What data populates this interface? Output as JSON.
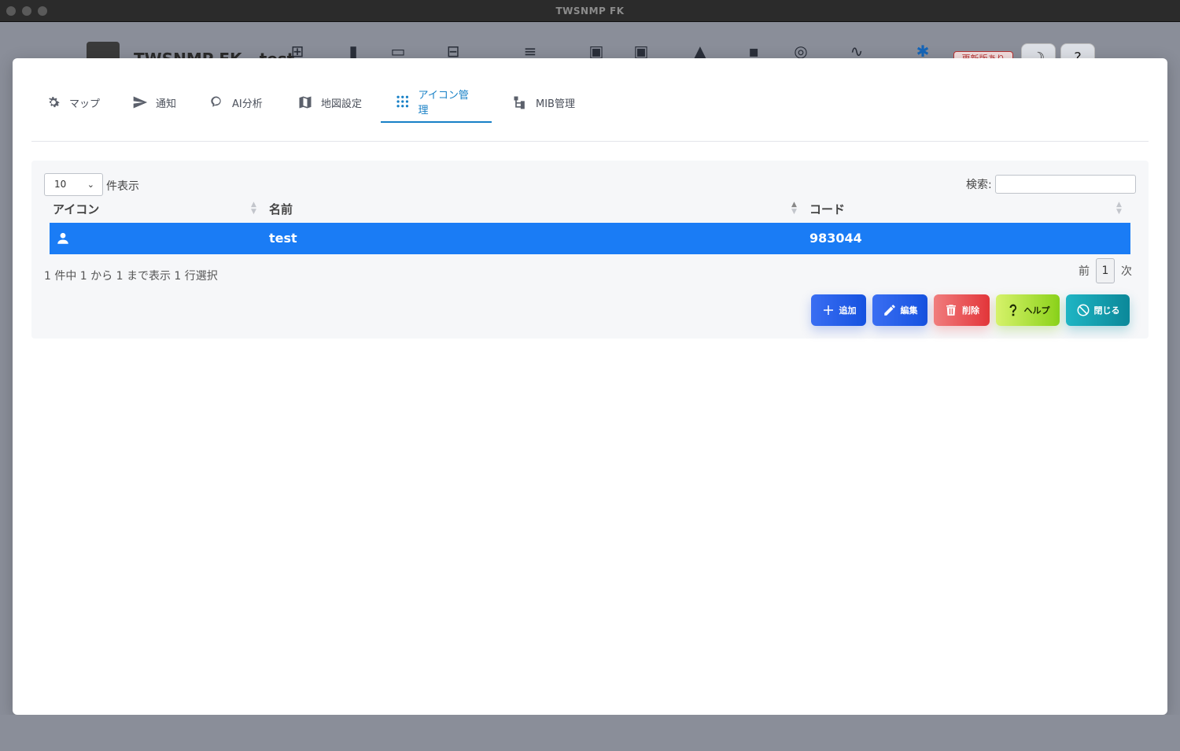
{
  "window": {
    "title": "TWSNMP FK"
  },
  "background_app": {
    "title": "TWSNMP FK - test",
    "update_badge": "更新版あり"
  },
  "tabs": [
    {
      "label": "マップ",
      "icon": "gear-icon"
    },
    {
      "label": "通知",
      "icon": "send-icon"
    },
    {
      "label": "AI分析",
      "icon": "brain-icon"
    },
    {
      "label": "地図設定",
      "icon": "map-icon"
    },
    {
      "label": "アイコン管理",
      "icon": "apps-grid-icon",
      "active": true
    },
    {
      "label": "MIB管理",
      "icon": "file-tree-icon"
    }
  ],
  "table": {
    "length_value": "10",
    "length_label": "件表示",
    "search_label": "検索:",
    "search_value": "",
    "columns": [
      "アイコン",
      "名前",
      "コード"
    ],
    "rows": [
      {
        "icon": "account-icon",
        "name": "test",
        "code": "983044",
        "selected": true
      }
    ],
    "info": "1 件中 1 から 1 まで表示 1 行選択",
    "pager": {
      "prev": "前",
      "current": "1",
      "next": "次"
    }
  },
  "buttons": {
    "add": "追加",
    "edit": "編集",
    "delete": "削除",
    "help": "ヘルプ",
    "close": "閉じる"
  },
  "colors": {
    "active_tab": "#1780c6",
    "selected_row": "#1a7cf5"
  }
}
